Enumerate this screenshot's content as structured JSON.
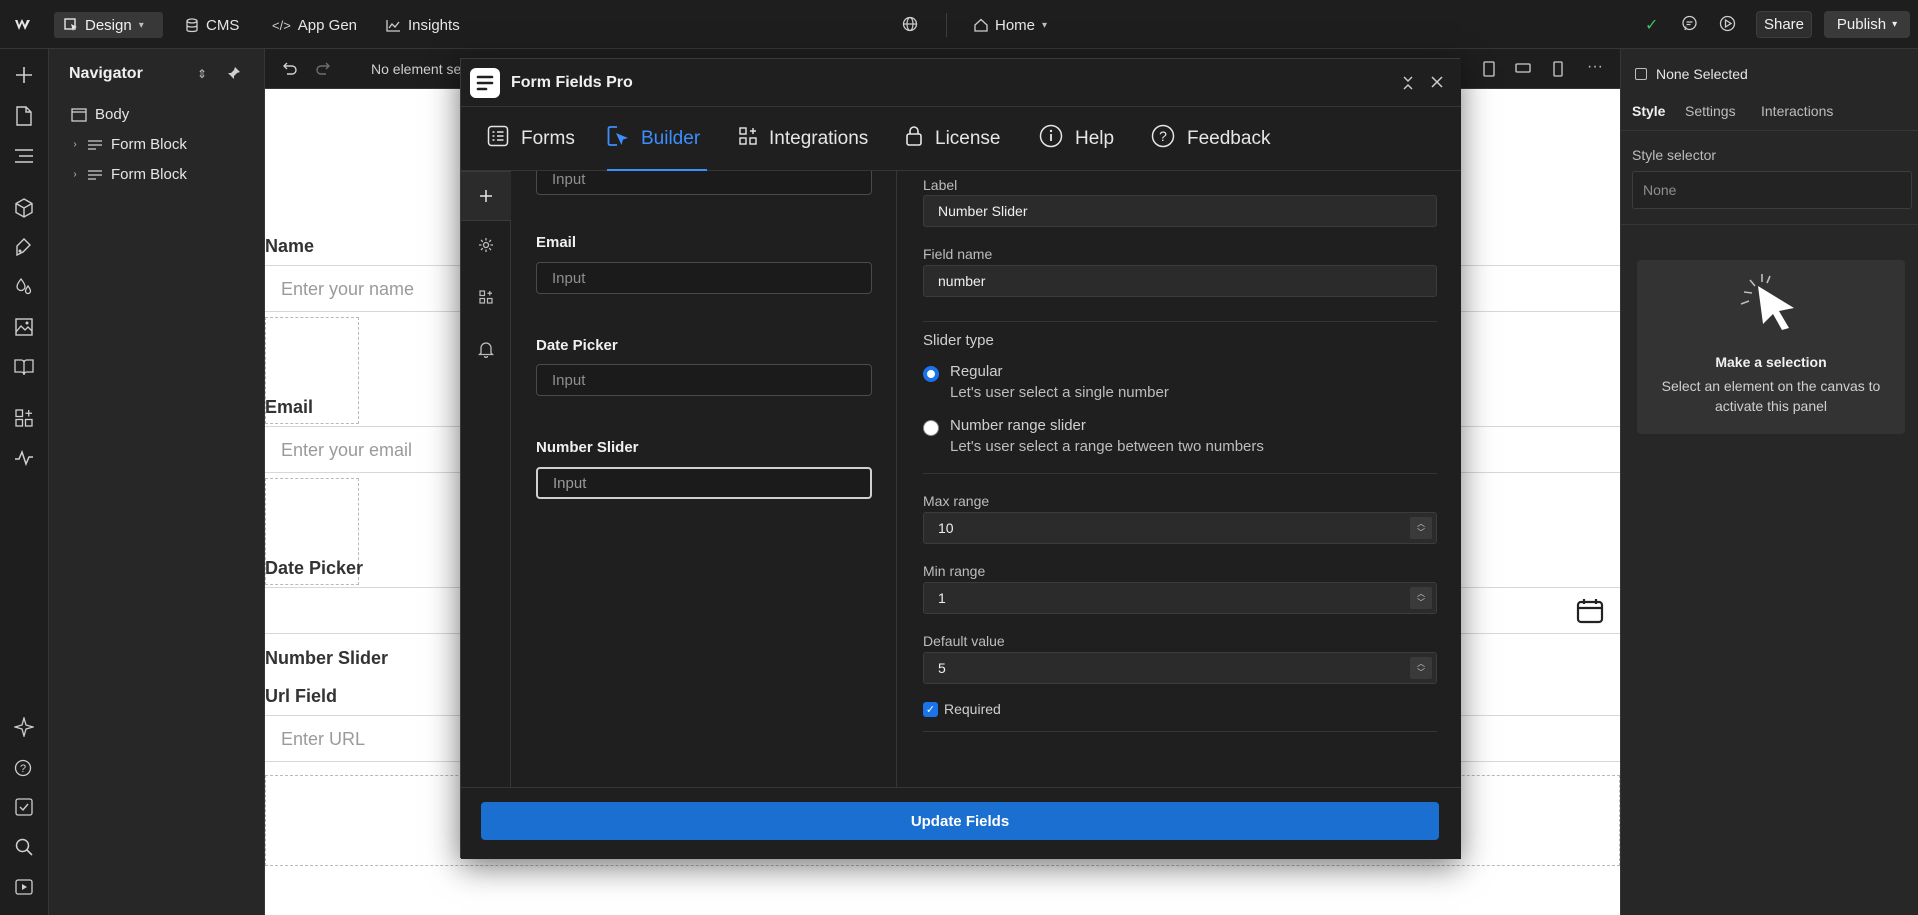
{
  "topbar": {
    "mode_label": "Design",
    "cms_label": "CMS",
    "appgen_label": "App Gen",
    "insights_label": "Insights",
    "page_label": "Home",
    "share_label": "Share",
    "publish_label": "Publish"
  },
  "navigator": {
    "title": "Navigator",
    "items": [
      {
        "label": "Body"
      },
      {
        "label": "Form Block"
      },
      {
        "label": "Form Block"
      }
    ]
  },
  "canvas_toolbar": {
    "selection_text": "No element se"
  },
  "canvas": {
    "fields": [
      {
        "label": "Name",
        "placeholder": "Enter your name"
      },
      {
        "label": "Email",
        "placeholder": "Enter your email"
      },
      {
        "label": "Date Picker",
        "placeholder": ""
      },
      {
        "label": "Number Slider"
      },
      {
        "label": "Url Field",
        "placeholder": "Enter URL"
      }
    ]
  },
  "right_panel": {
    "selection": "None Selected",
    "tabs": [
      "Style",
      "Settings",
      "Interactions"
    ],
    "style_selector_label": "Style selector",
    "style_selector_value": "None",
    "empty_title": "Make a selection",
    "empty_desc_1": "Select an element on the canvas to",
    "empty_desc_2": "activate this panel"
  },
  "modal": {
    "title": "Form Fields Pro",
    "tabs": [
      {
        "label": "Forms"
      },
      {
        "label": "Builder"
      },
      {
        "label": "Integrations"
      },
      {
        "label": "License"
      },
      {
        "label": "Help"
      },
      {
        "label": "Feedback"
      }
    ],
    "fields": [
      {
        "label": "",
        "placeholder": "Input"
      },
      {
        "label": "Email",
        "placeholder": "Input"
      },
      {
        "label": "Date Picker",
        "placeholder": "Input"
      },
      {
        "label": "Number Slider",
        "placeholder": "Input"
      }
    ],
    "settings": {
      "label_label": "Label",
      "label_value": "Number Slider",
      "field_name_label": "Field name",
      "field_name_value": "number",
      "slider_type_label": "Slider type",
      "option_regular": "Regular",
      "option_regular_desc": "Let's user select a single number",
      "option_range": "Number range slider",
      "option_range_desc": "Let's user select a range between two numbers",
      "max_label": "Max range",
      "max_value": "10",
      "min_label": "Min range",
      "min_value": "1",
      "default_label": "Default value",
      "default_value": "5",
      "required_label": "Required"
    },
    "update_button": "Update Fields"
  },
  "colors": {
    "accent": "#3d8eff",
    "primary_button": "#1a6fd1",
    "success": "#3fbf5f"
  }
}
